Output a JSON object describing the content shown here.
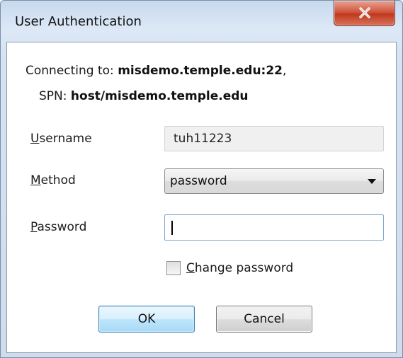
{
  "window": {
    "title": "User Authentication"
  },
  "connection": {
    "connecting_prefix": "Connecting to:",
    "host_port": "misdemo.temple.edu:22",
    "host_suffix": ",",
    "spn_prefix": "SPN:",
    "spn_value": "host/misdemo.temple.edu"
  },
  "form": {
    "username": {
      "mnemonic": "U",
      "label_rest": "sername",
      "value": "tuh11223"
    },
    "method": {
      "mnemonic": "M",
      "label_rest": "ethod",
      "value": "password"
    },
    "password": {
      "mnemonic": "P",
      "label_rest": "assword",
      "value": ""
    },
    "change_password": {
      "mnemonic": "C",
      "label_rest": "hange password",
      "checked": false
    }
  },
  "buttons": {
    "ok": "OK",
    "cancel": "Cancel"
  }
}
